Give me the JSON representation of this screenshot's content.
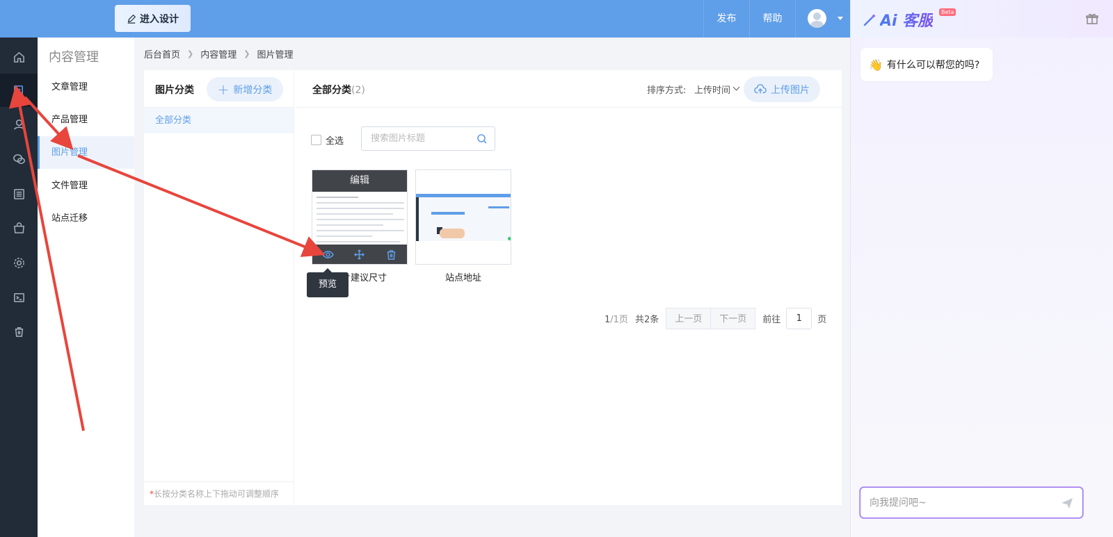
{
  "topbar": {
    "design_label": "进入设计",
    "publish_label": "发布",
    "help_label": "帮助"
  },
  "rail": {
    "icons": [
      "home-icon",
      "content-icon",
      "user-icon",
      "wechat-icon",
      "list-icon",
      "shop-icon",
      "settings-icon",
      "terminal-icon",
      "trash-icon"
    ],
    "active_index": 1
  },
  "subnav": {
    "title": "内容管理",
    "items": [
      {
        "label": "文章管理"
      },
      {
        "label": "产品管理"
      },
      {
        "label": "图片管理"
      },
      {
        "label": "文件管理"
      },
      {
        "label": "站点迁移"
      }
    ],
    "active_index": 2
  },
  "breadcrumb": {
    "items": [
      "后台首页",
      "内容管理",
      "图片管理"
    ]
  },
  "categories": {
    "title": "图片分类",
    "add_label": "新增分类",
    "items": [
      "全部分类"
    ],
    "hint_star": "*",
    "hint": "长按分类名称上下拖动可调整顺序"
  },
  "images_panel": {
    "title": "全部分类",
    "count": "(2)",
    "sort_label": "排序方式:",
    "sort_value": "上传时间",
    "upload_label": "上传图片",
    "select_all_label": "全选",
    "search_placeholder": "搜索图片标题",
    "images": [
      {
        "label": "图片建议尺寸",
        "edit_label": "编辑"
      },
      {
        "label": "站点地址"
      }
    ],
    "tooltip": "预览"
  },
  "pagination": {
    "current": "1",
    "total_pages": "/1页",
    "total_items": "共2条",
    "prev_label": "上一页",
    "next_label": "下一页",
    "goto_label": "前往",
    "goto_value": "1",
    "page_suffix": "页"
  },
  "ai_panel": {
    "logo_text": "Ai 客服",
    "beta": "Beta",
    "greeting": "有什么可以帮您的吗?",
    "input_placeholder": "向我提问吧~"
  },
  "colors": {
    "brand": "#5f9ee8",
    "rail_bg": "#222b38",
    "annotation_arrow": "#e8453c"
  }
}
